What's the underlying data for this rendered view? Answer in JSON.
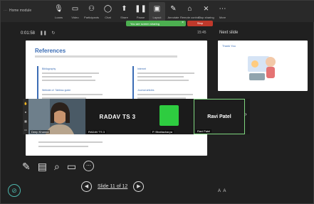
{
  "window": {
    "title": "Home module"
  },
  "toolbar": {
    "tools": [
      {
        "label": "Loans",
        "icon": "microphone-icon",
        "glyph": "🎙"
      },
      {
        "label": "Video",
        "icon": "camera-icon",
        "glyph": "▭"
      },
      {
        "label": "Participants",
        "icon": "people-icon",
        "glyph": "⚇"
      },
      {
        "label": "Chat",
        "icon": "chat-icon",
        "glyph": "◯"
      },
      {
        "label": "Share",
        "icon": "share-screen-icon",
        "glyph": "⬆"
      },
      {
        "label": "Pause",
        "icon": "pause-icon",
        "glyph": "❚❚"
      },
      {
        "label": "Layout",
        "icon": "layout-icon",
        "glyph": "▣"
      },
      {
        "label": "Annotate",
        "icon": "pen-icon",
        "glyph": "✎"
      },
      {
        "label": "Remote control",
        "icon": "remote-icon",
        "glyph": "⌂"
      },
      {
        "label": "Stop sharing",
        "icon": "stop-share-icon",
        "glyph": "⨯"
      },
      {
        "label": "More",
        "icon": "more-icon",
        "glyph": "⋯"
      }
    ],
    "sharing_notice": "You are screen sharing",
    "stop_label": "Stop"
  },
  "presenter": {
    "timer": "0:01:58",
    "slide_time": "15:45",
    "next_slide_label": "Next slide"
  },
  "slide": {
    "title": "References",
    "refs": [
      "Bibliography",
      "Internet",
      "Website of: Tableau guide",
      "Journal articles"
    ]
  },
  "next_slide": {
    "title": "Thank You"
  },
  "participants": {
    "video_name": "Deep Khanna",
    "tile2_big": "RADAV TS 3",
    "tile2_name": "RADAV TS 3",
    "tile3_name": "P. Bhattacharya",
    "tile4_big": "Ravi Patel",
    "tile4_name": "Ravi Patel"
  },
  "navigation": {
    "counter": "Slide 11 of 12"
  },
  "colors": {
    "accent": "#3b6db5",
    "share_green": "#4caf50",
    "tile_green": "#2ecc40"
  }
}
